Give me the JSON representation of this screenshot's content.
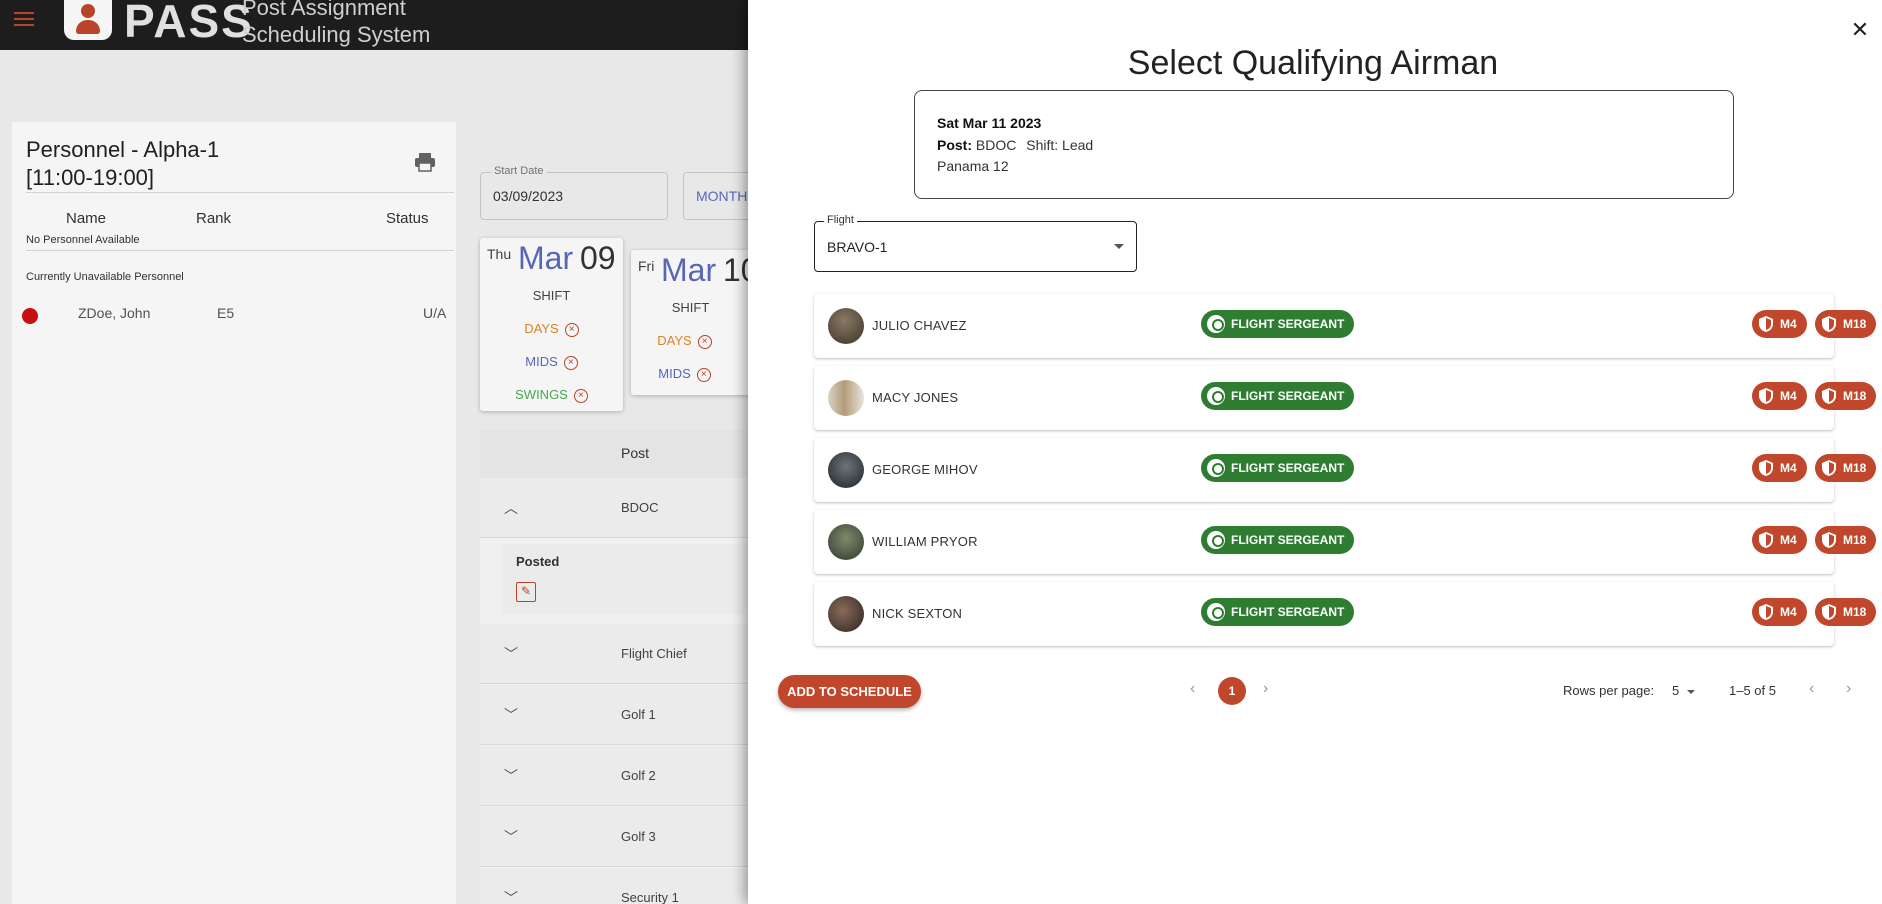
{
  "app": {
    "brand": "PASS",
    "brand_subtitle_line1": "Post Assignment",
    "brand_subtitle_line2": "Scheduling System"
  },
  "personnel": {
    "title_line1": "Personnel - Alpha-1",
    "title_line2": "[11:00-19:00]",
    "col_name": "Name",
    "col_rank": "Rank",
    "col_status": "Status",
    "no_personnel": "No Personnel Available",
    "unavailable_heading": "Currently Unavailable Personnel",
    "unavailable": [
      {
        "name": "ZDoe, John",
        "rank": "E5",
        "status": "U/A"
      }
    ]
  },
  "schedule": {
    "start_date_label": "Start Date",
    "start_date": "03/09/2023",
    "view_button": "MONTH",
    "days": [
      {
        "dow": "Thu",
        "month": "Mar",
        "day": "09",
        "shift_label": "SHIFT",
        "shifts": [
          "DAYS",
          "MIDS",
          "SWINGS"
        ]
      },
      {
        "dow": "Fri",
        "month": "Mar",
        "day": "10",
        "shift_label": "SHIFT",
        "shifts": [
          "DAYS",
          "MIDS"
        ]
      }
    ],
    "post_header": "Post",
    "posted_label": "Posted",
    "posts": [
      "BDOC",
      "Flight Chief",
      "Golf 1",
      "Golf 2",
      "Golf 3",
      "Security 1"
    ]
  },
  "drawer": {
    "title": "Select Qualifying Airman",
    "info": {
      "date": "Sat Mar 11 2023",
      "post_label": "Post:",
      "post_value": "BDOC",
      "shift_text": "Shift: Lead",
      "location": "Panama 12"
    },
    "flight": {
      "label": "Flight",
      "value": "BRAVO-1"
    },
    "airmen": [
      {
        "name": "JULIO CHAVEZ",
        "role": "FLIGHT SERGEANT",
        "weapons": [
          "M4",
          "M18"
        ]
      },
      {
        "name": "MACY JONES",
        "role": "FLIGHT SERGEANT",
        "weapons": [
          "M4",
          "M18"
        ]
      },
      {
        "name": "GEORGE MIHOV",
        "role": "FLIGHT SERGEANT",
        "weapons": [
          "M4",
          "M18"
        ]
      },
      {
        "name": "WILLIAM PRYOR",
        "role": "FLIGHT SERGEANT",
        "weapons": [
          "M4",
          "M18"
        ]
      },
      {
        "name": "NICK SEXTON",
        "role": "FLIGHT SERGEANT",
        "weapons": [
          "M4",
          "M18"
        ]
      }
    ],
    "add_button": "ADD TO SCHEDULE",
    "pagination": {
      "current_page": "1",
      "rows_per_page_label": "Rows per page:",
      "rows_per_page": "5",
      "range": "1–5 of 5"
    }
  },
  "colors": {
    "accent": "#c0472b",
    "role_chip": "#2e7d32",
    "link_blue": "#5c6bc0"
  }
}
